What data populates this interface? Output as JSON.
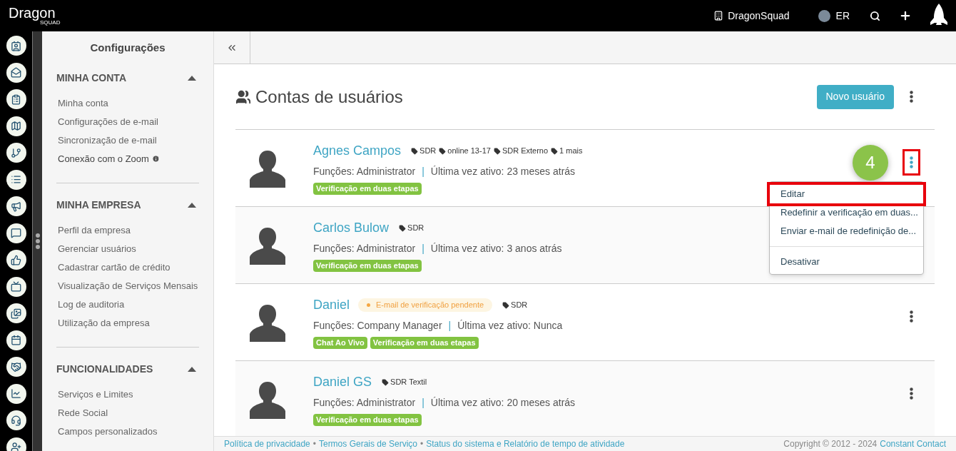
{
  "topbar": {
    "logo": "Dragon",
    "logo_sub": "SQUAD",
    "company": "DragonSquad",
    "user_initials": "ER"
  },
  "sidebar": {
    "title": "Configurações",
    "sections": [
      {
        "title": "MINHA CONTA",
        "expanded": true,
        "items": [
          {
            "label": "Minha conta",
            "info": false
          },
          {
            "label": "Configurações de e-mail",
            "info": false
          },
          {
            "label": "Sincronização de e-mail",
            "info": false
          },
          {
            "label": "Conexão com o Zoom",
            "info": true
          }
        ]
      },
      {
        "title": "MINHA EMPRESA",
        "expanded": true,
        "items": [
          {
            "label": "Perfil da empresa",
            "info": false
          },
          {
            "label": "Gerenciar usuários",
            "info": false
          },
          {
            "label": "Cadastrar cartão de crédito",
            "info": false
          },
          {
            "label": "Visualização de Serviços Mensais",
            "info": false
          },
          {
            "label": "Log de auditoria",
            "info": false
          },
          {
            "label": "Utilização da empresa",
            "info": false
          }
        ]
      },
      {
        "title": "FUNCIONALIDADES",
        "expanded": true,
        "items": [
          {
            "label": "Serviços e Limites",
            "info": false
          },
          {
            "label": "Rede Social",
            "info": false
          },
          {
            "label": "Campos personalizados",
            "info": false
          }
        ]
      }
    ]
  },
  "page": {
    "title": "Contas de usuários",
    "new_button": "Novo usuário"
  },
  "users": [
    {
      "name": "Agnes Campos",
      "tags": [
        "SDR",
        "online 13-17",
        "SDR Externo",
        "1 mais"
      ],
      "roles": "Funções: Administrator",
      "last_active": "Última vez ativo: 23 meses atrás",
      "badges": [
        "Verificação em duas etapas"
      ],
      "menu_open": true
    },
    {
      "name": "Carlos Bulow",
      "tags": [
        "SDR"
      ],
      "roles": "Funções: Administrator",
      "last_active": "Última vez ativo: 3 anos atrás",
      "badges": [
        "Verificação em duas etapas"
      ],
      "menu_open": false
    },
    {
      "name": "Daniel",
      "pending": "E-mail de verificação pendente",
      "tags": [
        "SDR"
      ],
      "roles": "Funções: Company Manager",
      "last_active": "Última vez ativo: Nunca",
      "badges": [
        "Chat Ao Vivo",
        "Verificação em duas etapas"
      ],
      "menu_open": false
    },
    {
      "name": "Daniel GS",
      "tags": [
        "SDR Textil"
      ],
      "roles": "Funções: Administrator",
      "last_active": "Última vez ativo: 20 meses atrás",
      "badges": [
        "Verificação em duas etapas"
      ],
      "menu_open": false
    }
  ],
  "row_menu": {
    "items": [
      {
        "label": "Editar",
        "highlighted": true,
        "divider_before": false
      },
      {
        "label": "Redefinir a verificação em duas...",
        "highlighted": false,
        "divider_before": false
      },
      {
        "label": "Enviar e-mail de redefinição de...",
        "highlighted": false,
        "divider_before": false
      },
      {
        "label": "Desativar",
        "highlighted": false,
        "divider_before": true
      }
    ]
  },
  "step_badge": "4",
  "row_separator": "|",
  "footer": {
    "separator": "•",
    "links": [
      "Política de privacidade",
      "Termos Gerais de Serviço",
      "Status do sistema e Relatório de tempo de atividade"
    ],
    "copyright": "Copyright © 2012 - 2024",
    "copyright_link": "Constant Contact"
  }
}
